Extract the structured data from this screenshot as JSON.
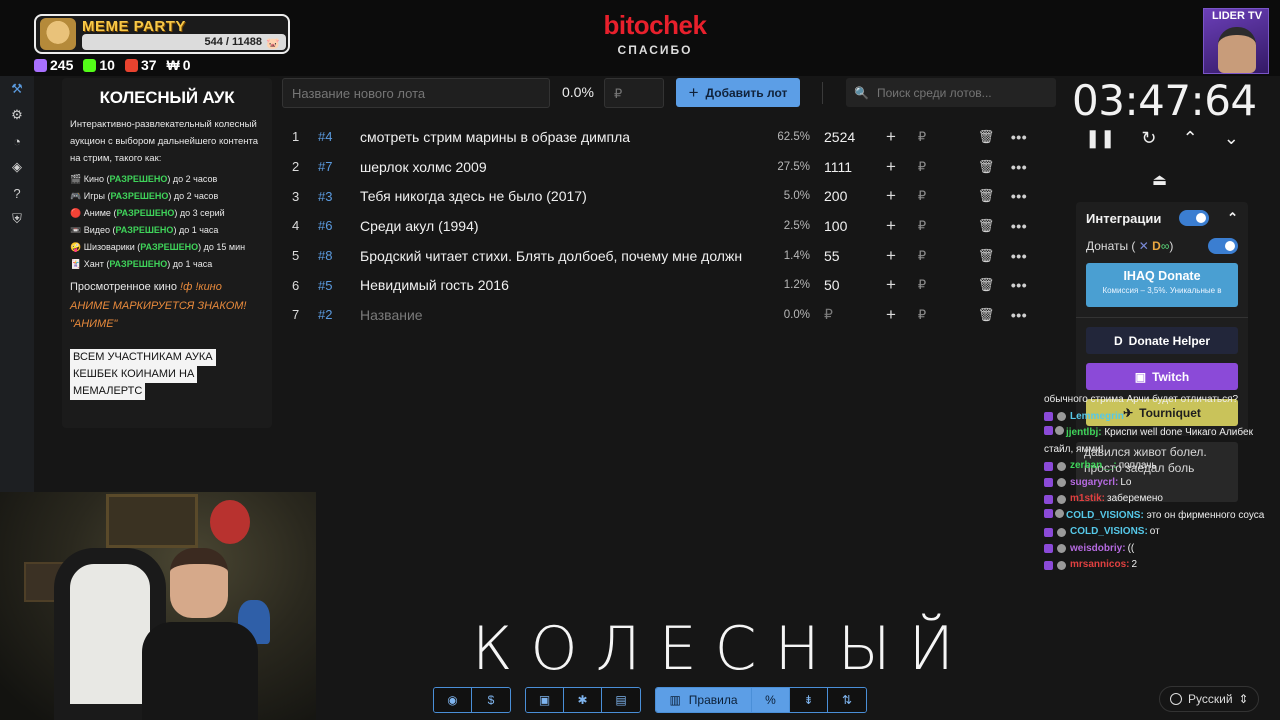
{
  "overlay": {
    "meme_title": "MEME PARTY",
    "meme_progress": "544 / 11488",
    "stats": [
      {
        "icon": "twitch-icon",
        "value": "245",
        "color": "#a970ff"
      },
      {
        "icon": "kick-icon",
        "value": "10",
        "color": "#53fc18"
      },
      {
        "icon": "live-icon",
        "value": "37",
        "color": "#e9432f"
      },
      {
        "icon": "w-icon",
        "value": "0",
        "color": "#ffffff"
      }
    ],
    "brand": "bitochek",
    "brand_sub": "СПАСИБО",
    "streamer_tag": "LIDER TV",
    "caption": "КОЛЕСНЫЙ"
  },
  "rules": {
    "title": "КОЛЕСНЫЙ АУК",
    "intro": "Интерактивно-развлекательный колесный аукцион с выбором дальнейшего контента на стрим, такого как:",
    "items": [
      {
        "emoji": "🎬",
        "name": "Кино",
        "status": "РАЗРЕШЕНО",
        "limit": "до 2 часов"
      },
      {
        "emoji": "🎮",
        "name": "Игры",
        "status": "РАЗРЕШЕНО",
        "limit": "до 2 часов"
      },
      {
        "emoji": "🔴",
        "name": "Аниме",
        "status": "РАЗРЕШЕНО",
        "limit": "до 3 серий"
      },
      {
        "emoji": "📼",
        "name": "Видео",
        "status": "РАЗРЕШЕНО",
        "limit": "до 1 часа"
      },
      {
        "emoji": "🤪",
        "name": "Шизоварики",
        "status": "РАЗРЕШЕНО",
        "limit": "до 15 мин"
      },
      {
        "emoji": "🃏",
        "name": "Хант",
        "status": "РАЗРЕШЕНО",
        "limit": "до 1 часа"
      }
    ],
    "watched_label": "Просмотренное кино",
    "watched_cmd": "!ф !кино",
    "anime_note_1": "АНИМЕ МАРКИРУЕТСЯ ЗНАКОМ!",
    "anime_note_2": "\"АНИМЕ\"",
    "cashback": [
      "ВСЕМ УЧАСТНИКАМ АУКА",
      "КЕШБЕК КОИНАМИ НА",
      "МЕМАЛЕРТС"
    ]
  },
  "toolbar": {
    "lot_name_placeholder": "Название нового лота",
    "percent": "0.0%",
    "price_placeholder": "₽",
    "add_button": "Добавить лот",
    "search_placeholder": "Поиск среди лотов..."
  },
  "lots": [
    {
      "index": "1",
      "id": "#4",
      "name": "смотреть стрим марины в образе димпла",
      "percent": "62.5%",
      "amount": "2524"
    },
    {
      "index": "2",
      "id": "#7",
      "name": "шерлок холмс 2009",
      "percent": "27.5%",
      "amount": "1111"
    },
    {
      "index": "3",
      "id": "#3",
      "name": "Тебя никогда здесь не было (2017)",
      "percent": "5.0%",
      "amount": "200"
    },
    {
      "index": "4",
      "id": "#6",
      "name": "Среди акул (1994)",
      "percent": "2.5%",
      "amount": "100"
    },
    {
      "index": "5",
      "id": "#8",
      "name": "Бродский читает стихи. Блять долбоеб, почему мне должн",
      "percent": "1.4%",
      "amount": "55"
    },
    {
      "index": "6",
      "id": "#5",
      "name": "Невидимый гость 2016",
      "percent": "1.2%",
      "amount": "50"
    },
    {
      "index": "7",
      "id": "#2",
      "name": "Название",
      "percent": "0.0%",
      "amount": "₽"
    }
  ],
  "lot_controls": {
    "plus": "+",
    "currency": "₽",
    "trash": "🗑",
    "more": "•••"
  },
  "timer": {
    "value": "03:47:64"
  },
  "integrations": {
    "title": "Интеграции",
    "donations_label": "Донаты (",
    "donations_tail": ")",
    "ihaq_title": "IHAQ Donate",
    "ihaq_sub": "Комиссия – 3,5%. Уникальные в",
    "donate_helper": "Donate Helper",
    "twitch": "Twitch",
    "tourniquet": "Tourniquet"
  },
  "donation_popup": {
    "line1": "давился живот болел.",
    "line2": "просто заедал боль"
  },
  "chat": [
    {
      "nick": "",
      "text": "обычного стрима Арчи будет отличаться?",
      "color": "w"
    },
    {
      "nick": "Lemmegrin",
      "text": "",
      "color": "c"
    },
    {
      "nick": "jjentlbj:",
      "text": "Криспи well done Чикаго Алибек стайл, ямми!",
      "color": "g"
    },
    {
      "nick": "zerban__:",
      "text": "поплачь",
      "color": "g"
    },
    {
      "nick": "sugarycrl:",
      "text": "Lo",
      "color": "p"
    },
    {
      "nick": "m1stik:",
      "text": "заберемено",
      "color": "r"
    },
    {
      "nick": "COLD_VISIONS:",
      "text": "это он фирменного соуса",
      "color": "c"
    },
    {
      "nick": "COLD_VISIONS:",
      "text": "от",
      "color": "c"
    },
    {
      "nick": "weisdobriy:",
      "text": "((",
      "color": "p"
    },
    {
      "nick": "mrsannicos:",
      "text": "2",
      "color": "r"
    }
  ],
  "bottom_bar": {
    "rules_label": "Правила"
  },
  "language": "Русский"
}
